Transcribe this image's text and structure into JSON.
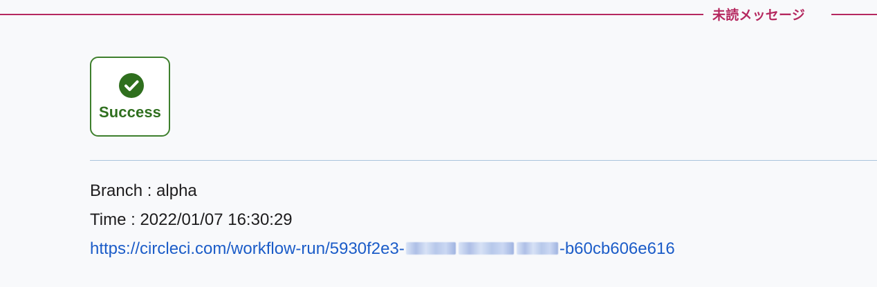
{
  "unread_divider": {
    "label": "未読メッセージ"
  },
  "success_badge": {
    "icon": "check-circle-icon",
    "label": "Success",
    "colors": {
      "border": "#3d7f2c",
      "icon": "#2f6f1e",
      "text": "#2f6f1e"
    }
  },
  "message": {
    "branch_line": "Branch : alpha",
    "time_line": "Time : 2022/01/07 16:30:29",
    "workflow_link": {
      "prefix": "https://circleci.com/workflow-run/5930f2e3-",
      "suffix": "-b60cb606e616",
      "color": "#1b5cc8"
    }
  },
  "colors": {
    "background": "#f8f9fb",
    "unread_accent": "#b5285f",
    "separator": "#a9c4dc"
  }
}
